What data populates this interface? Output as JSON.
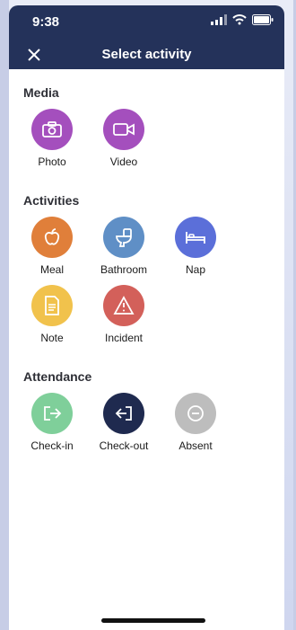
{
  "status_bar": {
    "time": "9:38"
  },
  "header": {
    "title": "Select activity"
  },
  "sections": [
    {
      "title": "Media",
      "items": [
        {
          "label": "Photo",
          "color": "#a44fbd",
          "icon": "camera-icon"
        },
        {
          "label": "Video",
          "color": "#a44fbd",
          "icon": "video-icon"
        }
      ]
    },
    {
      "title": "Activities",
      "items": [
        {
          "label": "Meal",
          "color": "#e07f3a",
          "icon": "apple-icon"
        },
        {
          "label": "Bathroom",
          "color": "#5f8fc6",
          "icon": "toilet-icon"
        },
        {
          "label": "Nap",
          "color": "#5b6fd9",
          "icon": "bed-icon"
        },
        {
          "label": "Note",
          "color": "#f1c24c",
          "icon": "note-icon"
        },
        {
          "label": "Incident",
          "color": "#d3605a",
          "icon": "warning-icon"
        }
      ]
    },
    {
      "title": "Attendance",
      "items": [
        {
          "label": "Check-in",
          "color": "#7fcf9a",
          "icon": "check-in-icon"
        },
        {
          "label": "Check-out",
          "color": "#1f2a4f",
          "icon": "check-out-icon"
        },
        {
          "label": "Absent",
          "color": "#bdbdbd",
          "icon": "absent-icon"
        }
      ]
    }
  ]
}
